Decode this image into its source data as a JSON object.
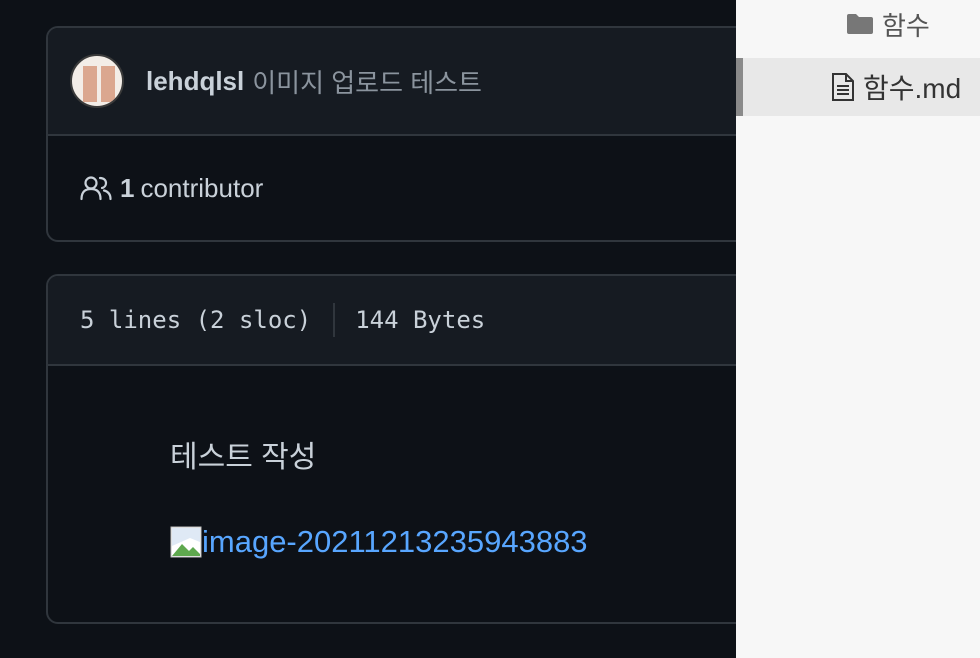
{
  "commit": {
    "author": "lehdqlsl",
    "message": "이미지 업로드 테스트"
  },
  "contributors": {
    "count": "1",
    "label": "contributor"
  },
  "file_info": {
    "lines": "5 lines (2 sloc)",
    "size": "144 Bytes"
  },
  "content": {
    "text": "테스트 작성",
    "image_alt": "image-20211213235943883"
  },
  "sidebar": {
    "folder": "함수",
    "file": "함수.md"
  },
  "colors": {
    "background": "#0d1117",
    "header": "#161b22",
    "border": "#30363d",
    "link": "#58a6ff",
    "sidebar": "#f7f7f7"
  }
}
